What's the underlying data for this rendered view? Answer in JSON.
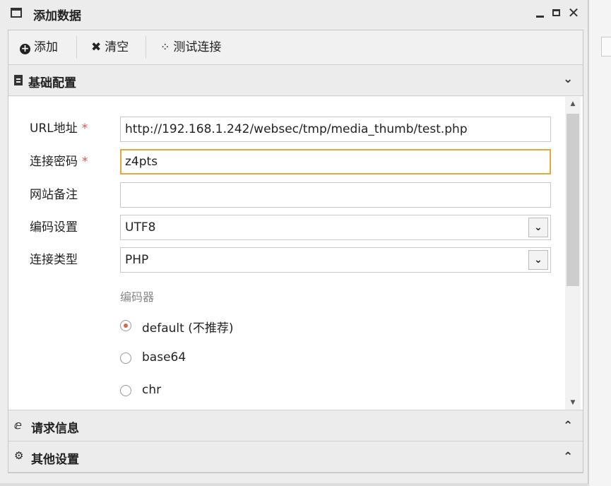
{
  "window": {
    "title": "添加数据",
    "close_glyph": "✕"
  },
  "toolbar": {
    "add_label": "添加",
    "clear_label": "清空",
    "test_label": "测试连接"
  },
  "sections": {
    "basic": {
      "label": "基础配置",
      "icon": "file-icon",
      "state": "expanded"
    },
    "request": {
      "label": "请求信息",
      "icon": "ie-icon",
      "state": "collapsed"
    },
    "other": {
      "label": "其他设置",
      "icon": "gears-icon",
      "state": "collapsed"
    }
  },
  "form": {
    "url": {
      "label": "URL地址",
      "required_mark": "*",
      "value": "http://192.168.1.242/websec/tmp/media_thumb/test.php"
    },
    "password": {
      "label": "连接密码",
      "required_mark": "*",
      "value": "z4pts"
    },
    "note": {
      "label": "网站备注",
      "value": ""
    },
    "encoding": {
      "label": "编码设置",
      "value": "UTF8"
    },
    "type": {
      "label": "连接类型",
      "value": "PHP"
    },
    "encoder": {
      "label": "编码器",
      "options": [
        {
          "label": "default (不推荐)",
          "checked": true
        },
        {
          "label": "base64",
          "checked": false
        },
        {
          "label": "chr",
          "checked": false
        }
      ]
    }
  },
  "colors": {
    "focus_border": "#e5a93a",
    "required": "#d9534f",
    "radio_checked": "#d26b4a"
  }
}
